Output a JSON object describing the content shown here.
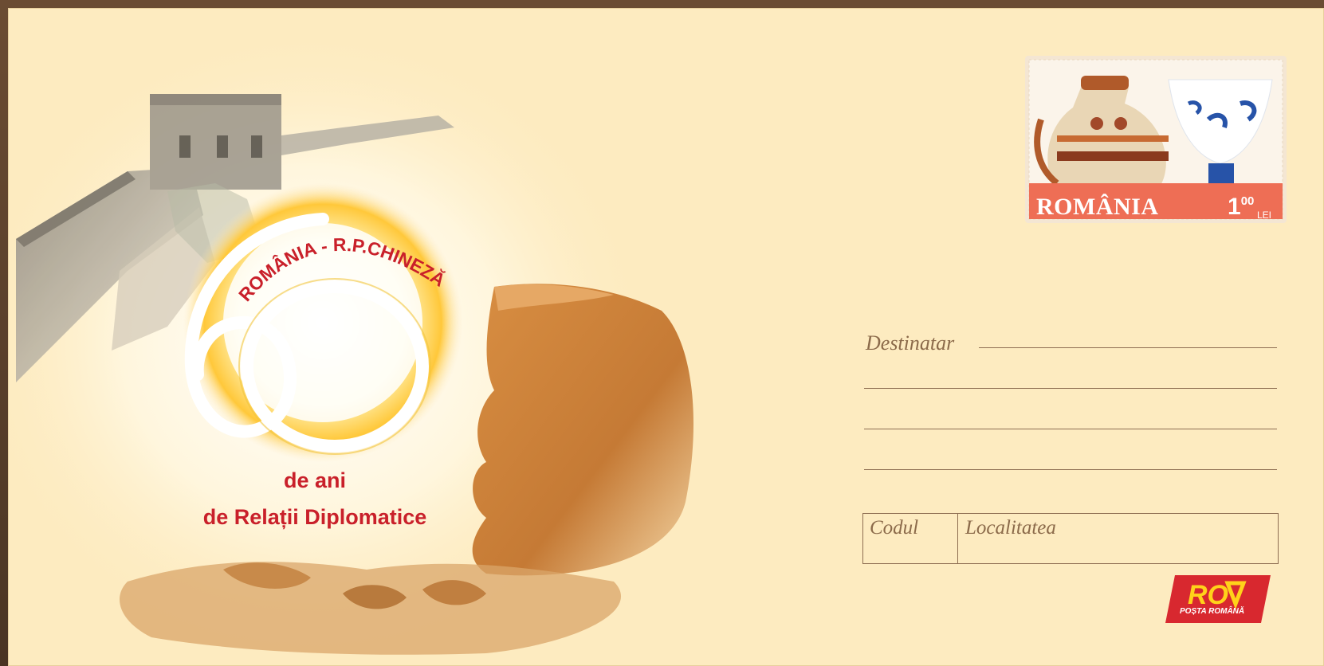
{
  "logo_text": {
    "arc": "ROMÂNIA - R.P.CHINEZĂ",
    "line1": "de ani",
    "line2": "de Relații Diplomatice"
  },
  "stamp": {
    "country": "ROMÂNIA",
    "value_main": "1",
    "value_fraction": "00",
    "currency": "LEI"
  },
  "address": {
    "recipient_label": "Destinatar",
    "code_label": "Codul",
    "locality_label": "Localitatea"
  },
  "postal_logo": {
    "mark": "RO",
    "name": "POȘTA ROMÂNĂ"
  },
  "colors": {
    "envelope": "#fdebc0",
    "red": "#c9202a",
    "stamp_band": "#ee6e55",
    "line": "#8e6e52"
  }
}
